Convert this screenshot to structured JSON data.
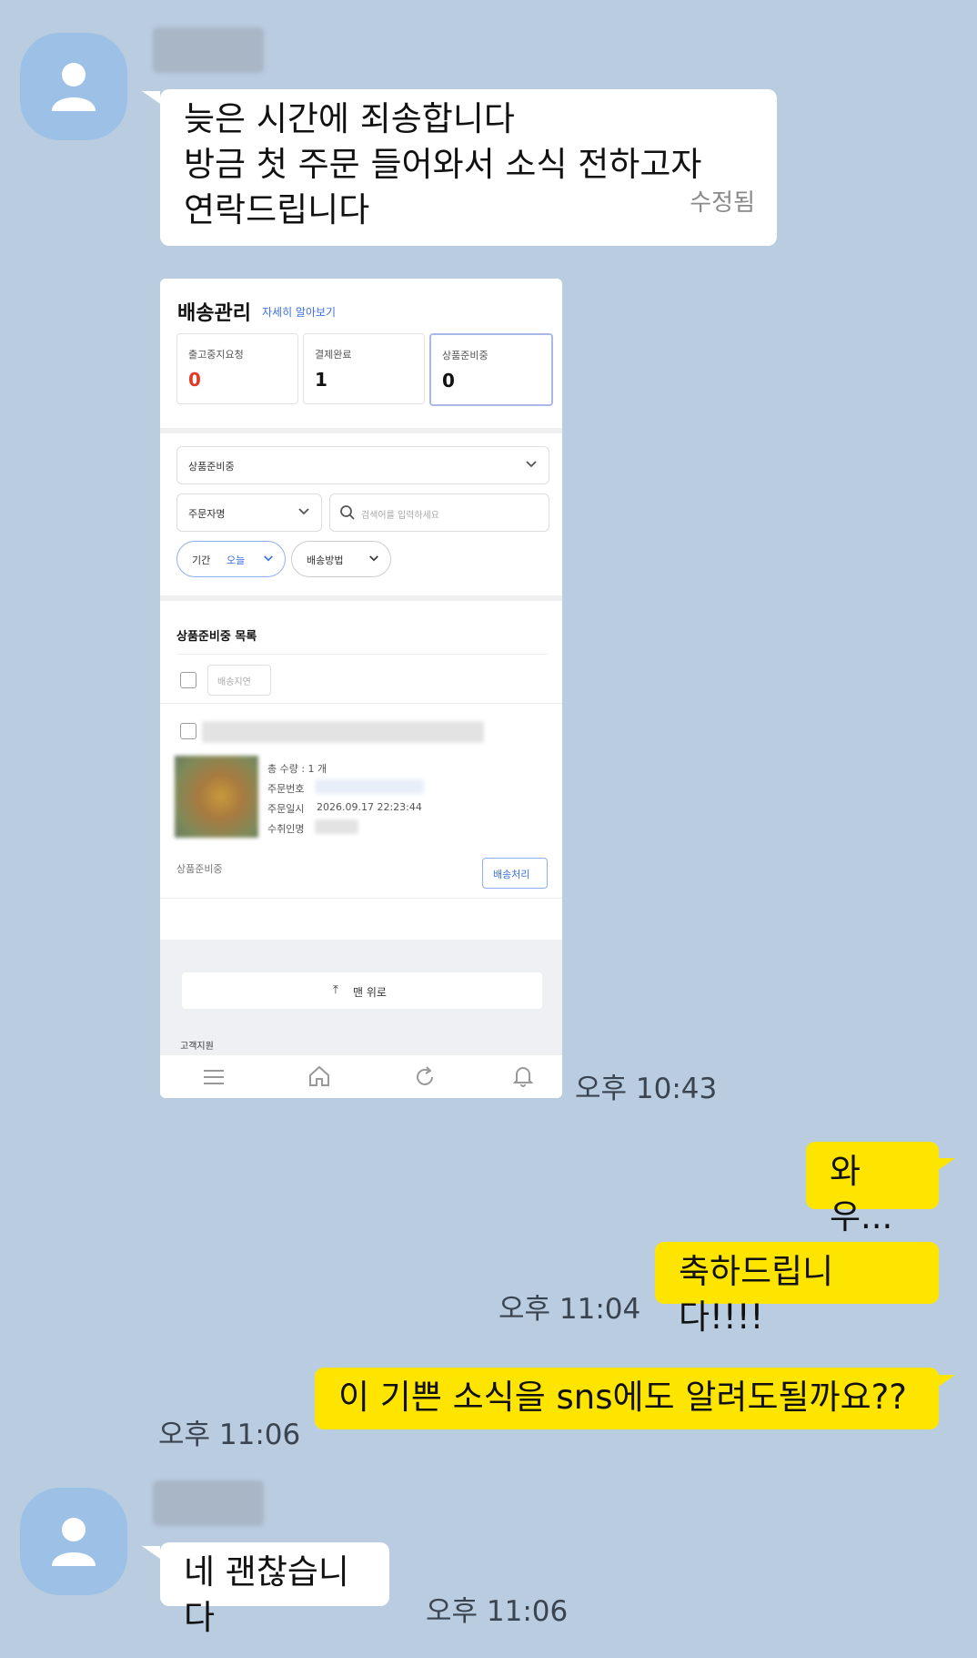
{
  "messages": {
    "incoming_1": {
      "lines": [
        "늦은 시간에 죄송합니다",
        "방금 첫 주문 들어와서 소식 전하고자",
        "연락드립니다"
      ],
      "edited_label": "수정됨",
      "time": "오후 10:43"
    },
    "outgoing_1": {
      "text": "와우..."
    },
    "outgoing_2": {
      "text": "축하드립니다!!!!",
      "time": "오후 11:04"
    },
    "outgoing_3": {
      "text": "이 기쁜 소식을 sns에도 알려도될까요??",
      "time": "오후 11:06"
    },
    "incoming_2": {
      "text": "네 괜찮습니다",
      "time": "오후 11:06"
    }
  },
  "screenshot": {
    "title": "배송관리",
    "help_link": "자세히 알아보기",
    "stats": [
      {
        "label": "출고중지요청",
        "value": "0",
        "color": "#e03a2a"
      },
      {
        "label": "결제완료",
        "value": "1",
        "color": "#111111"
      },
      {
        "label": "상품준비중",
        "value": "0",
        "color": "#111111"
      }
    ],
    "status_select": "상품준비중",
    "search_type_select": "주문자명",
    "search_placeholder": "검색어를 입력하세요",
    "period_label": "기간",
    "period_value": "오늘",
    "shipping_method_label": "배송방법",
    "list_title": "상품준비중 목록",
    "delay_button": "배송지연",
    "order": {
      "qty_line": "총 수량 : 1 개",
      "order_no_label": "주문번호",
      "order_date_label": "주문일시",
      "order_date_value": "2026.09.17 22:23:44",
      "recipient_label": "수취인명",
      "status": "상품준비중",
      "process_button": "배송처리"
    },
    "top_button": "맨 위로",
    "customer_support": "고객지원"
  },
  "colors": {
    "background": "#b9cce0",
    "my_bubble": "#fee500",
    "their_bubble": "#ffffff",
    "avatar": "#9dc1e6"
  }
}
